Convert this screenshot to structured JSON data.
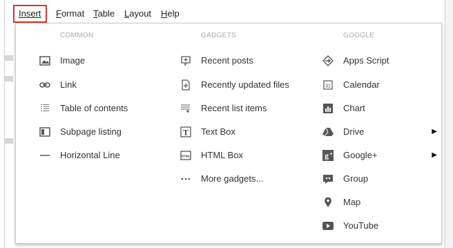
{
  "menubar": {
    "items": [
      {
        "label": "Insert",
        "underline_index": 0
      },
      {
        "label": "Format",
        "underline_index": 0
      },
      {
        "label": "Table",
        "underline_index": 0
      },
      {
        "label": "Layout",
        "underline_index": 0
      },
      {
        "label": "Help",
        "underline_index": 0
      }
    ]
  },
  "dropdown": {
    "columns": [
      {
        "header": "COMMON",
        "items": [
          {
            "label": "Image",
            "icon": "image-icon"
          },
          {
            "label": "Link",
            "icon": "link-icon"
          },
          {
            "label": "Table of contents",
            "icon": "table-of-contents-icon"
          },
          {
            "label": "Subpage listing",
            "icon": "subpage-listing-icon"
          },
          {
            "label": "Horizontal Line",
            "icon": "horizontal-line-icon"
          }
        ]
      },
      {
        "header": "GADGETS",
        "items": [
          {
            "label": "Recent posts",
            "icon": "recent-posts-icon"
          },
          {
            "label": "Recently updated files",
            "icon": "recently-updated-files-icon"
          },
          {
            "label": "Recent list items",
            "icon": "recent-list-items-icon"
          },
          {
            "label": "Text Box",
            "icon": "text-box-icon"
          },
          {
            "label": "HTML Box",
            "icon": "html-box-icon"
          },
          {
            "label": "More gadgets...",
            "icon": "more-gadgets-icon"
          }
        ]
      },
      {
        "header": "GOOGLE",
        "items": [
          {
            "label": "Apps Script",
            "icon": "apps-script-icon"
          },
          {
            "label": "Calendar",
            "icon": "calendar-icon"
          },
          {
            "label": "Chart",
            "icon": "chart-icon"
          },
          {
            "label": "Drive",
            "icon": "drive-icon",
            "submenu": true
          },
          {
            "label": "Google+",
            "icon": "google-plus-icon",
            "submenu": true
          },
          {
            "label": "Group",
            "icon": "group-icon"
          },
          {
            "label": "Map",
            "icon": "map-pin-icon"
          },
          {
            "label": "YouTube",
            "icon": "youtube-icon"
          }
        ]
      }
    ]
  },
  "colors": {
    "active_menu_border": "#d9342b",
    "header_text": "#aaaaaa",
    "item_text": "#333333"
  }
}
